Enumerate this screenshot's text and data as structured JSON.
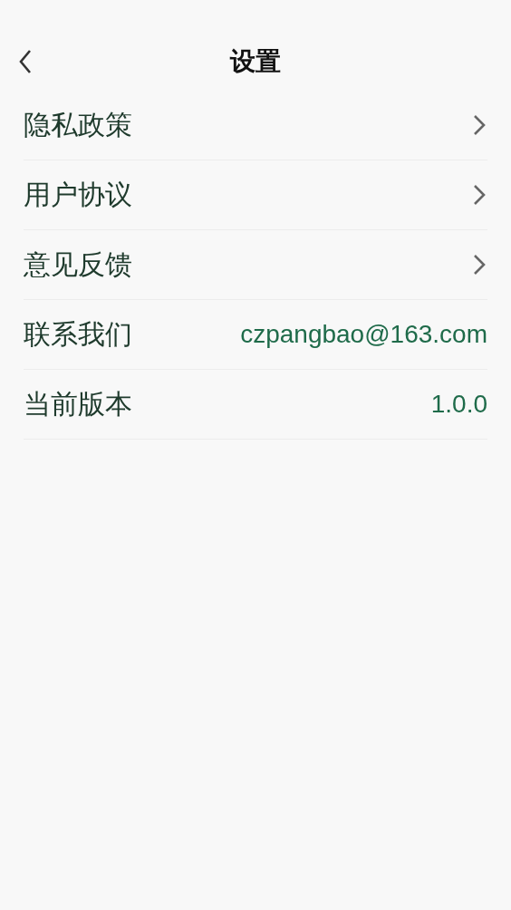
{
  "header": {
    "title": "设置"
  },
  "items": [
    {
      "label": "隐私政策",
      "kind": "link"
    },
    {
      "label": "用户协议",
      "kind": "link"
    },
    {
      "label": "意见反馈",
      "kind": "link"
    },
    {
      "label": "联系我们",
      "kind": "value",
      "value": "czpangbao@163.com"
    },
    {
      "label": "当前版本",
      "kind": "value",
      "value": "1.0.0"
    }
  ]
}
